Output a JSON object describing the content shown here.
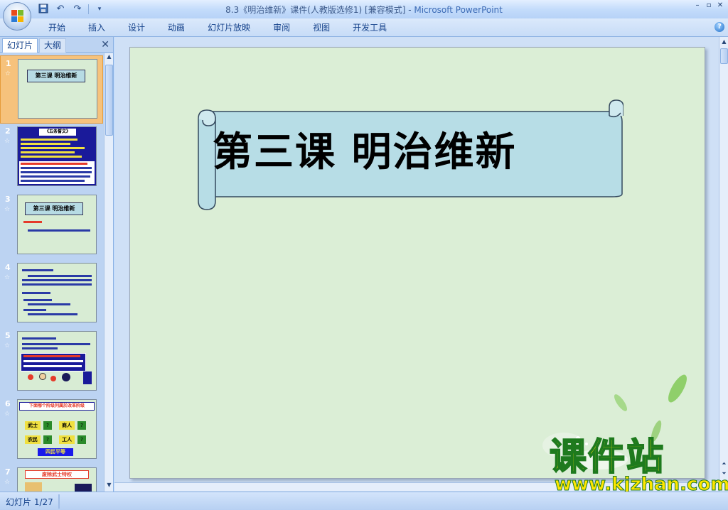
{
  "window": {
    "title": "8.3《明治维新》课件(人教版选修1) [兼容模式]",
    "title_sep": " - ",
    "app_name": "Microsoft PowerPoint"
  },
  "quick_access": {
    "save_icon": "save-icon",
    "undo_icon": "undo-icon",
    "redo_icon": "redo-icon"
  },
  "ribbon": {
    "tabs": [
      "开始",
      "插入",
      "设计",
      "动画",
      "幻灯片放映",
      "审阅",
      "视图",
      "开发工具"
    ]
  },
  "left_pane": {
    "tabs": [
      "幻灯片",
      "大纲"
    ]
  },
  "thumbnails": [
    {
      "num": "1",
      "star": "☆",
      "title": "第三课  明治维新"
    },
    {
      "num": "2",
      "star": "☆",
      "title": "《五条誓文》"
    },
    {
      "num": "3",
      "star": "☆",
      "title": "第三课  明治维新"
    },
    {
      "num": "4",
      "star": "☆"
    },
    {
      "num": "5",
      "star": "☆"
    },
    {
      "num": "6",
      "star": "☆",
      "title": "下面哪个阶级列属於改革阶级",
      "cells": [
        "武士",
        "?",
        "商人",
        "?",
        "农民",
        "?",
        "工人",
        "?",
        "四民平等"
      ]
    },
    {
      "num": "7",
      "star": "☆",
      "title": "废除武士特权"
    }
  ],
  "slide": {
    "title": "第三课   明治维新"
  },
  "watermark": {
    "line1": "课件站",
    "line2": "www.kjzhan.com"
  },
  "status": {
    "slide_counter": "幻灯片 1/27"
  },
  "colors": {
    "slide_bg": "#dbeed6",
    "banner_fill": "#b7dde6",
    "selected_thumb": "#f6c27c",
    "watermark_fill": "#ffe600",
    "watermark_stroke": "#1e7a1e"
  }
}
